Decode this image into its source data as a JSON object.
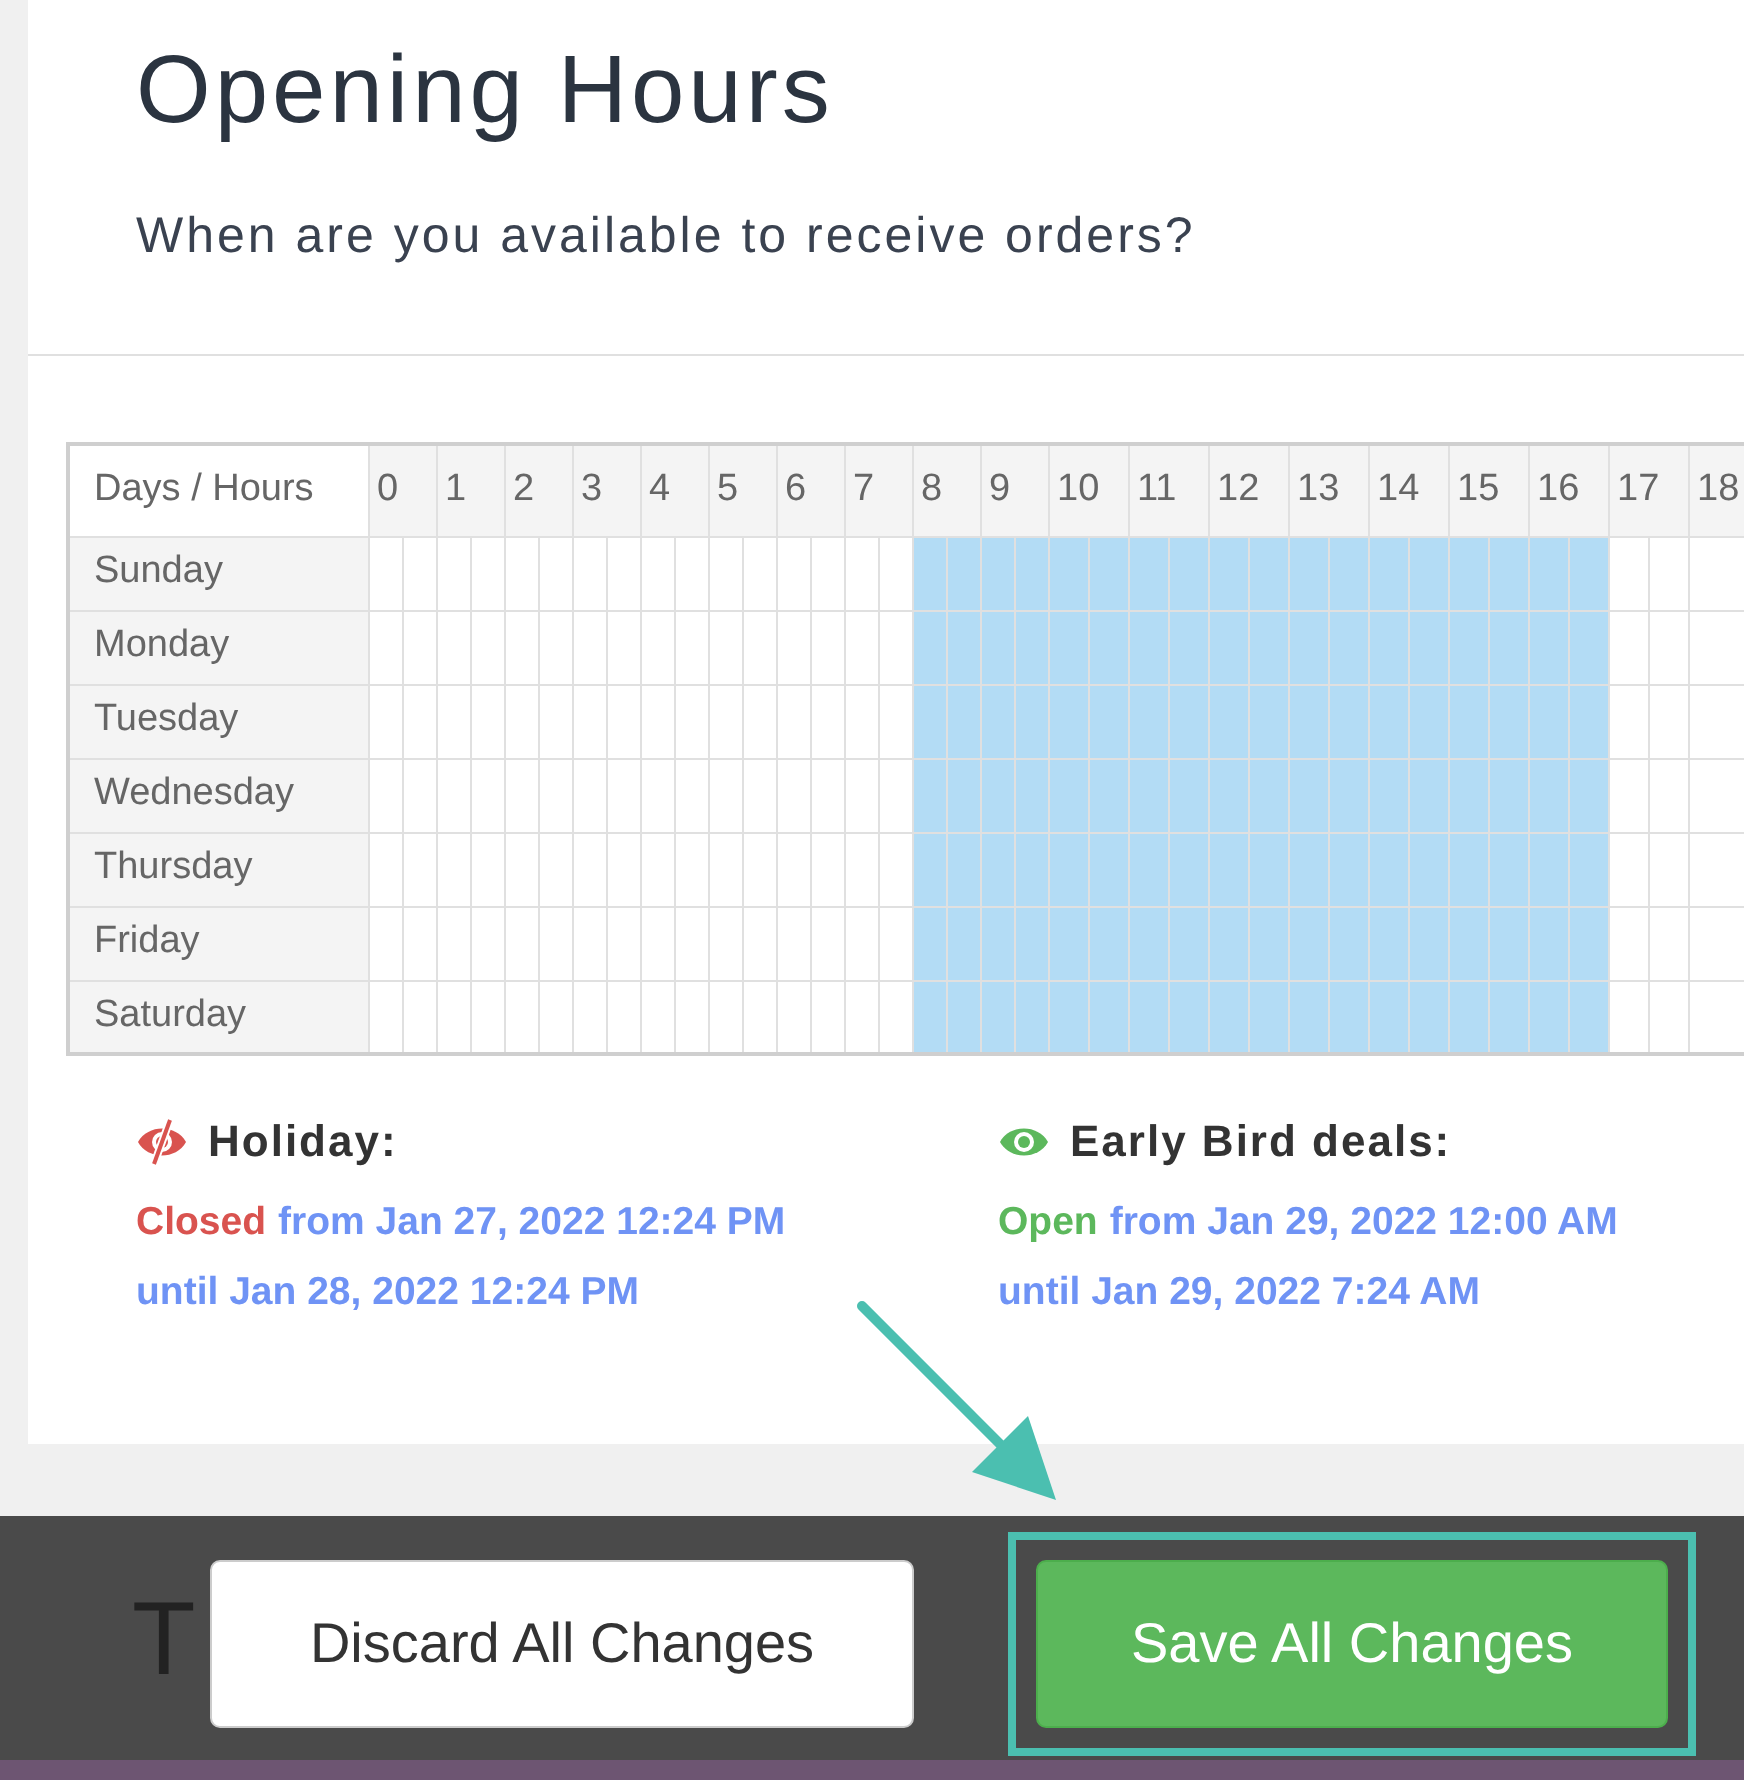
{
  "page": {
    "title": "Opening Hours",
    "subtitle": "When are you available to receive orders?"
  },
  "schedule": {
    "corner": "Days / Hours",
    "hours": [
      "0",
      "1",
      "2",
      "3",
      "4",
      "5",
      "6",
      "7",
      "8",
      "9",
      "10",
      "11",
      "12",
      "13",
      "14",
      "15",
      "16",
      "17",
      "18"
    ],
    "days": [
      {
        "name": "Sunday",
        "slots": [
          false,
          false,
          false,
          false,
          false,
          false,
          false,
          false,
          false,
          false,
          false,
          false,
          false,
          false,
          false,
          false,
          true,
          true,
          true,
          true,
          true,
          true,
          true,
          true,
          true,
          true,
          true,
          true,
          true,
          true,
          true,
          true,
          true,
          true,
          false,
          false,
          false
        ]
      },
      {
        "name": "Monday",
        "slots": [
          false,
          false,
          false,
          false,
          false,
          false,
          false,
          false,
          false,
          false,
          false,
          false,
          false,
          false,
          false,
          false,
          true,
          true,
          true,
          true,
          true,
          true,
          true,
          true,
          true,
          true,
          true,
          true,
          true,
          true,
          true,
          true,
          true,
          true,
          false,
          false,
          false
        ]
      },
      {
        "name": "Tuesday",
        "slots": [
          false,
          false,
          false,
          false,
          false,
          false,
          false,
          false,
          false,
          false,
          false,
          false,
          false,
          false,
          false,
          false,
          true,
          true,
          true,
          true,
          true,
          true,
          true,
          true,
          true,
          true,
          true,
          true,
          true,
          true,
          true,
          true,
          true,
          true,
          false,
          false,
          false
        ]
      },
      {
        "name": "Wednesday",
        "slots": [
          false,
          false,
          false,
          false,
          false,
          false,
          false,
          false,
          false,
          false,
          false,
          false,
          false,
          false,
          false,
          false,
          true,
          true,
          true,
          true,
          true,
          true,
          true,
          true,
          true,
          true,
          true,
          true,
          true,
          true,
          true,
          true,
          true,
          true,
          false,
          false,
          false
        ]
      },
      {
        "name": "Thursday",
        "slots": [
          false,
          false,
          false,
          false,
          false,
          false,
          false,
          false,
          false,
          false,
          false,
          false,
          false,
          false,
          false,
          false,
          true,
          true,
          true,
          true,
          true,
          true,
          true,
          true,
          true,
          true,
          true,
          true,
          true,
          true,
          true,
          true,
          true,
          true,
          false,
          false,
          false
        ]
      },
      {
        "name": "Friday",
        "slots": [
          false,
          false,
          false,
          false,
          false,
          false,
          false,
          false,
          false,
          false,
          false,
          false,
          false,
          false,
          false,
          false,
          true,
          true,
          true,
          true,
          true,
          true,
          true,
          true,
          true,
          true,
          true,
          true,
          true,
          true,
          true,
          true,
          true,
          true,
          false,
          false,
          false
        ]
      },
      {
        "name": "Saturday",
        "slots": [
          false,
          false,
          false,
          false,
          false,
          false,
          false,
          false,
          false,
          false,
          false,
          false,
          false,
          false,
          false,
          false,
          true,
          true,
          true,
          true,
          true,
          true,
          true,
          true,
          true,
          true,
          true,
          true,
          true,
          true,
          true,
          true,
          true,
          true,
          false,
          false,
          false
        ]
      }
    ]
  },
  "exceptions": [
    {
      "title": "Holiday:",
      "open": false,
      "status": "Closed",
      "from": "from Jan 27, 2022 12:24 PM",
      "until": "until Jan 28, 2022 12:24 PM"
    },
    {
      "title": "Early Bird deals:",
      "open": true,
      "status": "Open",
      "from": "from Jan 29, 2022 12:00 AM",
      "until": "until Jan 29, 2022 7:24 AM"
    }
  ],
  "action_bar": {
    "hidden_heading": "T",
    "buttons": [
      {
        "label": "Discard All Changes",
        "kind": "secondary",
        "highlighted": false
      },
      {
        "label": "Save All Changes",
        "kind": "primary",
        "highlighted": true
      }
    ]
  }
}
